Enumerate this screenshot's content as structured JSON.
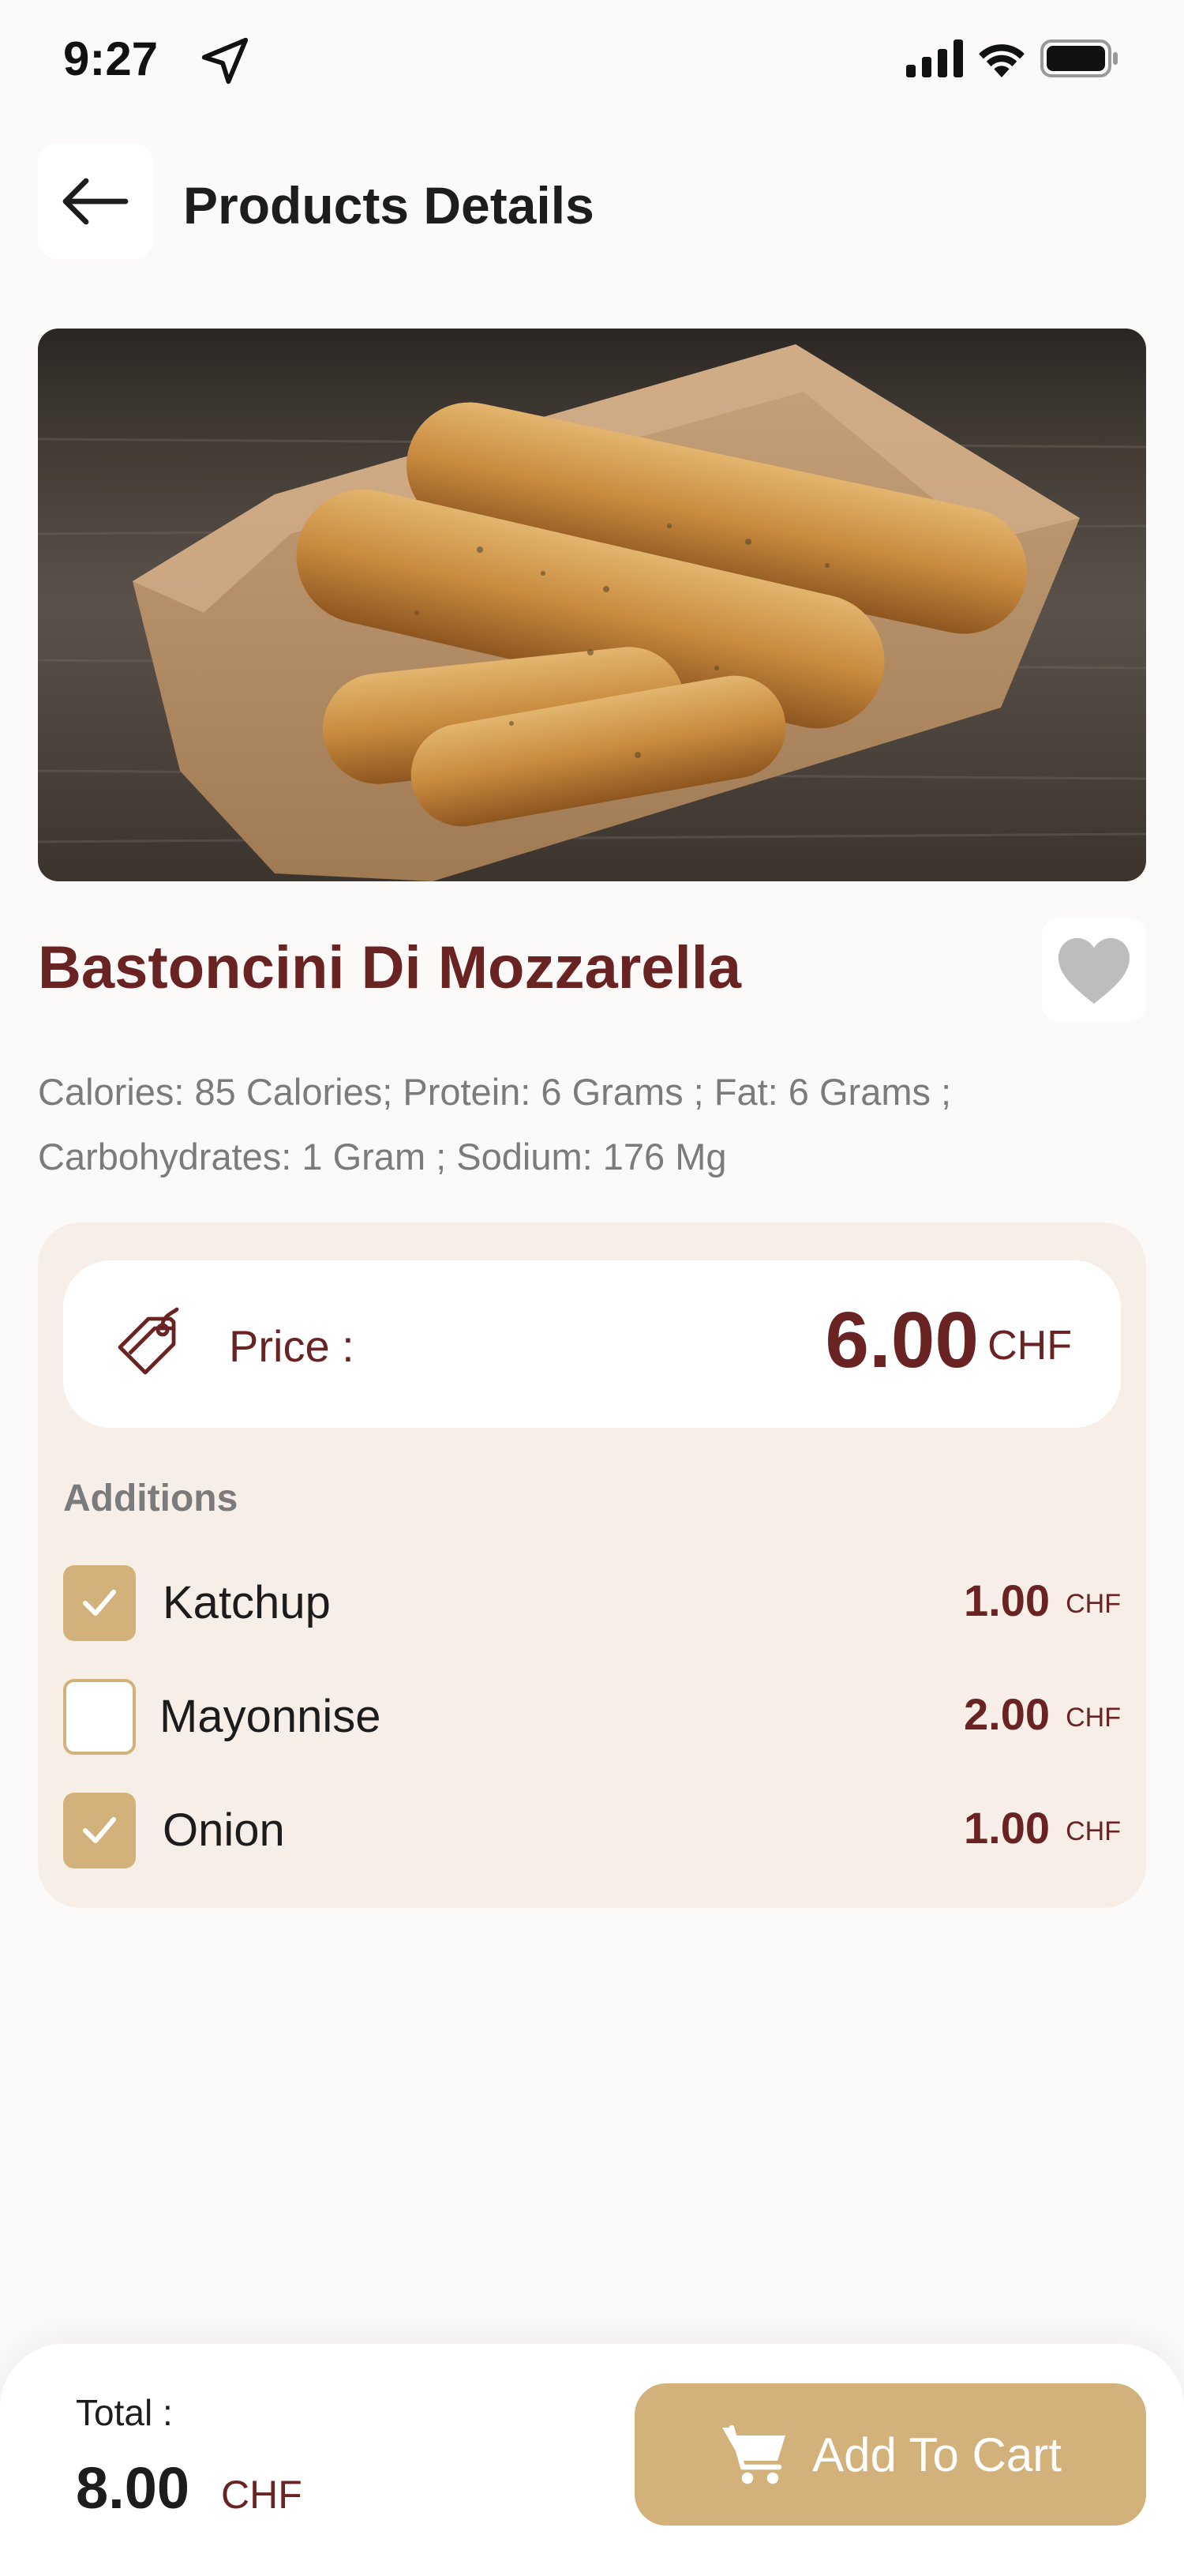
{
  "status_bar": {
    "time": "9:27",
    "icons": [
      "location-arrow-icon",
      "signal-icon",
      "wifi-icon",
      "battery-icon"
    ]
  },
  "header": {
    "back_icon": "arrow-left-icon",
    "title": "Products Details"
  },
  "product": {
    "image_description": "mozzarella-sticks-image",
    "name": "Bastoncini Di Mozzarella",
    "favorite_icon": "heart-icon",
    "description": "Calories: 85 Calories; Protein: 6 Grams ; Fat: 6 Grams ; Carbohydrates: 1 Gram ; Sodium: 176 Mg"
  },
  "price": {
    "icon": "price-tag-icon",
    "label": "Price :",
    "value": "6.00",
    "currency": "CHF"
  },
  "additions": {
    "title": "Additions",
    "items": [
      {
        "name": "Katchup",
        "price": "1.00",
        "currency": "CHF",
        "checked": true
      },
      {
        "name": "Mayonnise",
        "price": "2.00",
        "currency": "CHF",
        "checked": false
      },
      {
        "name": "Onion",
        "price": "1.00",
        "currency": "CHF",
        "checked": true
      }
    ]
  },
  "footer": {
    "total_label": "Total :",
    "total_value": "8.00",
    "total_currency": "CHF",
    "add_to_cart_label": "Add To Cart",
    "cart_icon": "cart-icon"
  },
  "colors": {
    "background": "#fcfaf8",
    "accent": "#d2b17a",
    "brand_dark": "#6a2323",
    "card_background": "#f7efe7",
    "muted_text": "#7b7b7b",
    "favorite_inactive": "#bdbdbd"
  }
}
